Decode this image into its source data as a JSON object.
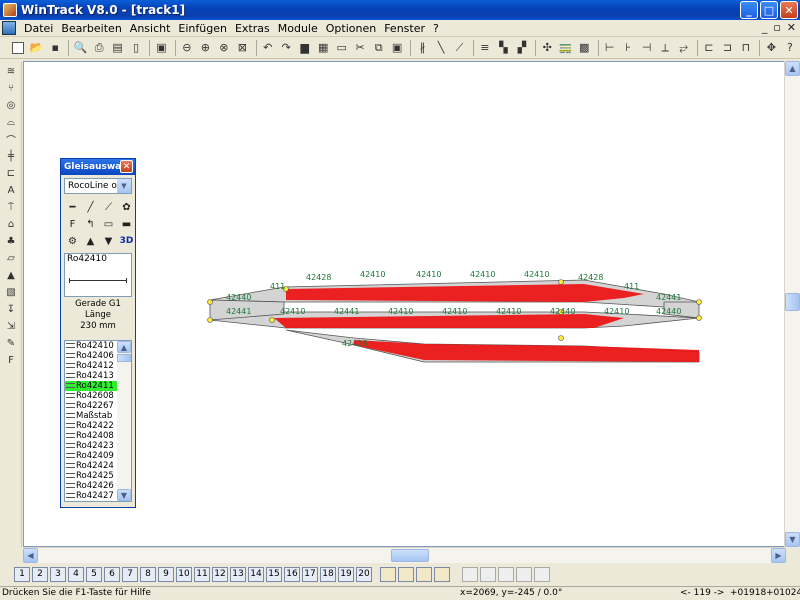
{
  "window": {
    "title": "WinTrack  V8.0 - [track1]",
    "buttons": {
      "minimize": "_",
      "maximize": "□",
      "close": "✕"
    }
  },
  "menu": {
    "items": [
      "Datei",
      "Bearbeiten",
      "Ansicht",
      "Einfügen",
      "Extras",
      "Module",
      "Optionen",
      "Fenster",
      "?"
    ],
    "mdi_buttons": [
      "_",
      "▫",
      "✕"
    ]
  },
  "palette": {
    "title": "Gleisauswa...",
    "close": "✕",
    "system": "RocoLine ohr",
    "tools": [
      "━",
      "╱",
      "⟋",
      "✿",
      "F",
      "↰",
      "▭",
      "▬",
      "⚙",
      "▲",
      "▼",
      "3D"
    ],
    "preview_label": "Ro42410",
    "description_line1": "Gerade G1 Länge",
    "description_line2": "230 mm",
    "list": [
      "Ro42410",
      "Ro42406",
      "Ro42412",
      "Ro42413",
      "Ro42411",
      "Ro42608",
      "Ro42267",
      "Maßstab",
      "Ro42422",
      "Ro42408",
      "Ro42423",
      "Ro42409",
      "Ro42424",
      "Ro42425",
      "Ro42426",
      "Ro42427"
    ],
    "selected_index": 4
  },
  "track_labels": {
    "upper": [
      "42440",
      "411",
      "42428",
      "42410",
      "42410",
      "42410",
      "42410",
      "42428",
      "411",
      "42441"
    ],
    "middle": [
      "42441",
      "42410",
      "42441",
      "42410",
      "42410",
      "42410",
      "42440",
      "42410",
      "42440"
    ],
    "lower": [
      "42428"
    ]
  },
  "colors": {
    "track_label": "#1a7a3a",
    "red_fill": "#ee1111",
    "selected": "#2ef02e",
    "title_bar": "#0a46c0"
  },
  "pages": [
    "1",
    "2",
    "3",
    "4",
    "5",
    "6",
    "7",
    "8",
    "9",
    "10",
    "11",
    "12",
    "13",
    "14",
    "15",
    "16",
    "17",
    "18",
    "19",
    "20"
  ],
  "status": {
    "help": "Drücken Sie die  F1-Taste für Hilfe",
    "coords": "x=2069, y=-245 / 0.0°",
    "zoom": "<- 119 ->",
    "pos1": "+01918",
    "pos2": "+01024"
  }
}
